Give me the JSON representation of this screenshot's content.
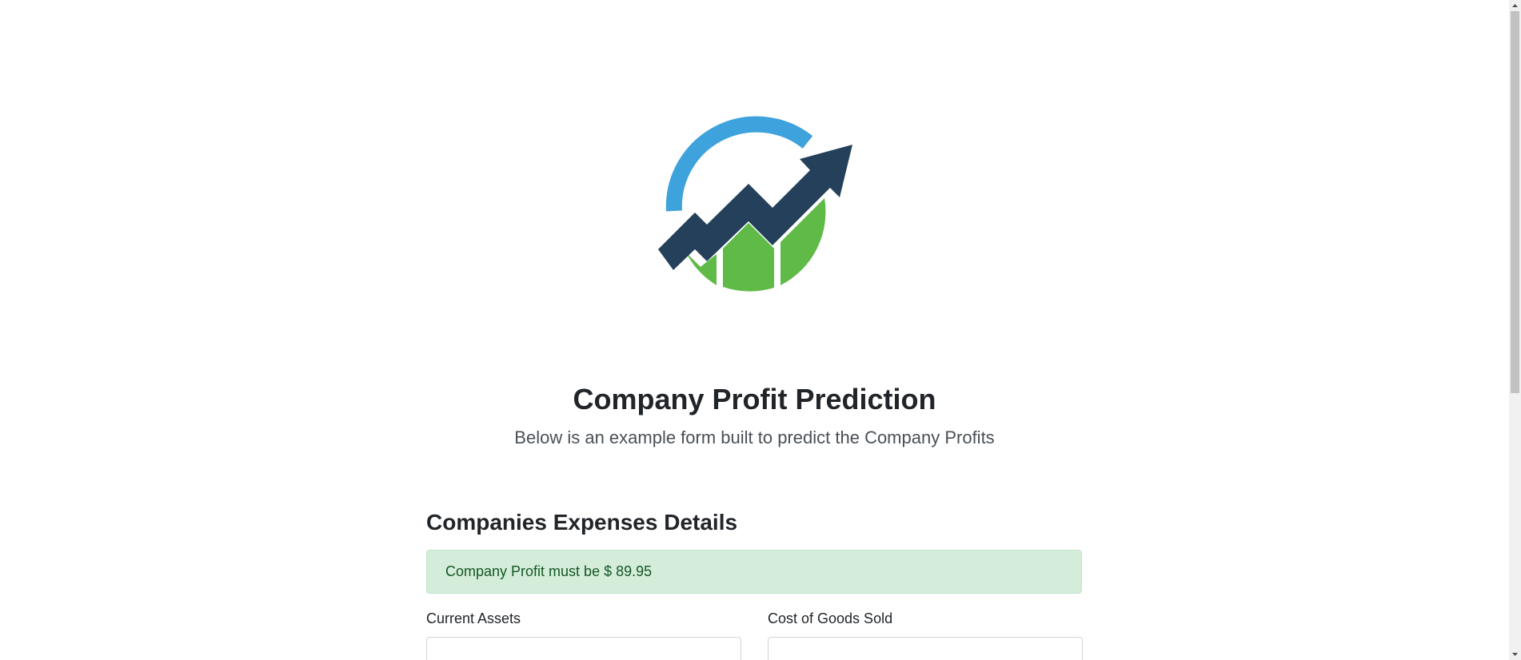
{
  "header": {
    "logo_icon": "growth-chart-logo-icon",
    "title": "Company Profit Prediction",
    "subtitle": "Below is an example form built to predict the Company Profits"
  },
  "form": {
    "section_title": "Companies Expenses Details",
    "alert": {
      "text": "Company Profit must be $ 89.95",
      "status": "success",
      "background": "#d4edda",
      "color": "#155724"
    },
    "fields": [
      {
        "label": "Current Assets",
        "value": "",
        "placeholder": ""
      },
      {
        "label": "Cost of Goods Sold",
        "value": "",
        "placeholder": ""
      }
    ]
  },
  "colors": {
    "logo_blue": "#3ea3dc",
    "logo_navy": "#24405a",
    "logo_green": "#5fba47"
  }
}
